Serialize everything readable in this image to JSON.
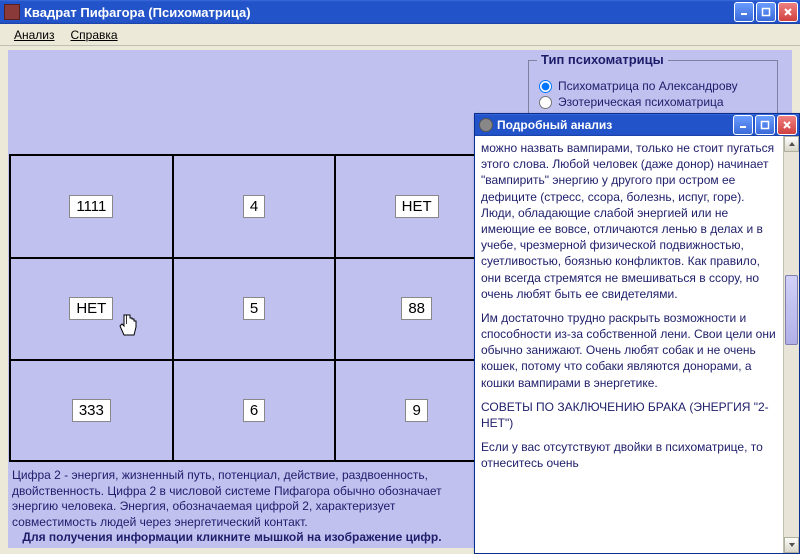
{
  "app": {
    "title": "Квадрат Пифагора (Психоматрица)"
  },
  "menu": {
    "analysis": "Анализ",
    "help": "Справка"
  },
  "type_panel": {
    "legend": "Тип психоматрицы",
    "opt1": "Психоматрица по Александрову",
    "opt2": "Эзотерическая психоматрица"
  },
  "grid": {
    "cells": [
      "1111",
      "4",
      "НЕТ",
      "НЕТ",
      "5",
      "88",
      "333",
      "6",
      "9"
    ]
  },
  "desc": "Цифра 2 - энергия, жизненный путь, потенциал, действие, раздвоенность, двойственность. Цифра 2 в числовой системе Пифагора обычно обозначает энергию человека. Энергия, обозначаемая цифрой 2, характеризует совместимость людей через энергетический контакт.",
  "hint": "Для получения информации кликните мышкой на изображение цифр.",
  "subwin": {
    "title": "Подробный анализ",
    "p1": "можно назвать вампирами, только не стоит пугаться этого слова. Любой человек (даже донор) начинает \"вампирить\" энергию у другого при остром ее дефиците (стресс, ссора, болезнь, испуг, горе). Люди, обладающие слабой энергией или не имеющие ее вовсе, отличаются ленью в делах и в учебе, чрезмерной физической подвижностью, суетливостью, боязнью конфликтов. Как правило, они всегда стремятся не вмешиваться в ссору, но очень любят быть ее свидетелями.",
    "p2": " Им достаточно трудно раскрыть возможности и способности из-за собственной лени. Свои цели они обычно занижают. Очень любят собак и не очень кошек, потому что собаки являются донорами, а кошки вампирами в энергетике.",
    "p3": "СОВЕТЫ ПО ЗАКЛЮЧЕНИЮ БРАКА (ЭНЕРГИЯ \"2-НЕТ\")",
    "p4": " Если у вас отсутствуют двойки в психоматрице, то отнеситесь очень"
  }
}
